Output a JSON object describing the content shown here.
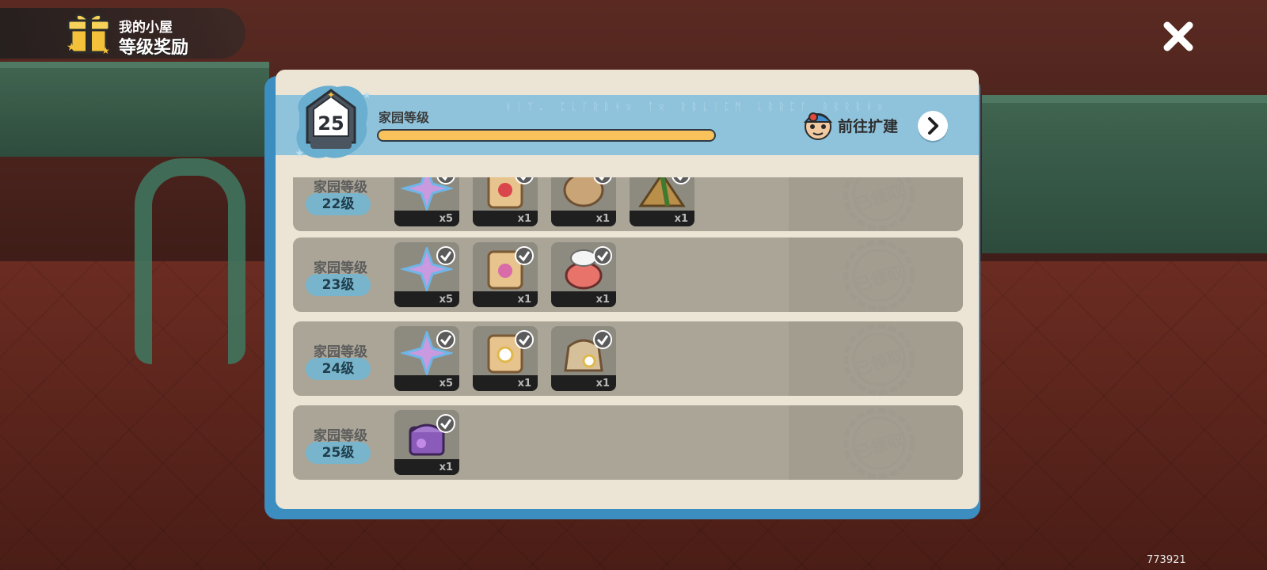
{
  "title": {
    "sub": "我的小屋",
    "main": "等级奖励"
  },
  "header": {
    "level_badge": "25",
    "home_level_label": "家园等级",
    "progress_fraction": 1.0,
    "expand_label": "前往扩建"
  },
  "rows": [
    {
      "label": "家园等级",
      "level": "22级",
      "status": "已领取",
      "items": [
        {
          "icon": "crystal-flower-icon",
          "count": "x5"
        },
        {
          "icon": "rose-seed-bag-icon",
          "count": "x1"
        },
        {
          "icon": "wooden-item-icon",
          "count": "x1"
        },
        {
          "icon": "tent-icon",
          "count": "x1"
        }
      ]
    },
    {
      "label": "家园等级",
      "level": "23级",
      "status": "已领取",
      "items": [
        {
          "icon": "crystal-flower-icon",
          "count": "x5"
        },
        {
          "icon": "pink-flower-seed-bag-icon",
          "count": "x1"
        },
        {
          "icon": "chef-pig-icon",
          "count": "x1"
        }
      ]
    },
    {
      "label": "家园等级",
      "level": "24级",
      "status": "已领取",
      "items": [
        {
          "icon": "crystal-flower-icon",
          "count": "x5"
        },
        {
          "icon": "daisy-seed-bag-icon",
          "count": "x1"
        },
        {
          "icon": "daisy-sack-icon",
          "count": "x1"
        }
      ]
    },
    {
      "label": "家园等级",
      "level": "25级",
      "status": "已领取",
      "items": [
        {
          "icon": "purple-chest-icon",
          "count": "x1"
        }
      ]
    }
  ],
  "watermark": "773921",
  "colors": {
    "accent_blue": "#8fc3dc",
    "progress_yellow": "#f9c25a",
    "panel_bg": "#ece5d6"
  }
}
